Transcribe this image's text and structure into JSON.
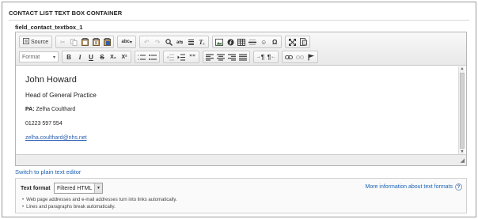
{
  "section": {
    "title": "CONTACT LIST TEXT BOX CONTAINER"
  },
  "field": {
    "label": "field_contact_textbox_1"
  },
  "toolbar": {
    "source_label": "Source",
    "format_placeholder": "Format",
    "bold": "B",
    "italic": "I",
    "underline": "U",
    "strike": "S",
    "subscript": "X₂",
    "superscript": "X²",
    "clear_format": "Tₓ",
    "paragraph_ltr": "¶",
    "paragraph_rtl": "¶",
    "blockquote": "””",
    "omega": "Ω"
  },
  "content": {
    "name": "John Howard",
    "role": "Head of General Practice",
    "pa_label": "PA:",
    "pa_name": " Zelha Coulthard",
    "phone": "01223 597 554",
    "email": "zelha.coulthard@nhs.net"
  },
  "switch_link": "Switch to plain text editor",
  "text_format": {
    "label": "Text format",
    "selected": "Filtered HTML",
    "more_info": "More information about text formats",
    "tips": [
      "Web page addresses and e-mail addresses turn into links automatically.",
      "Lines and paragraphs break automatically."
    ]
  }
}
